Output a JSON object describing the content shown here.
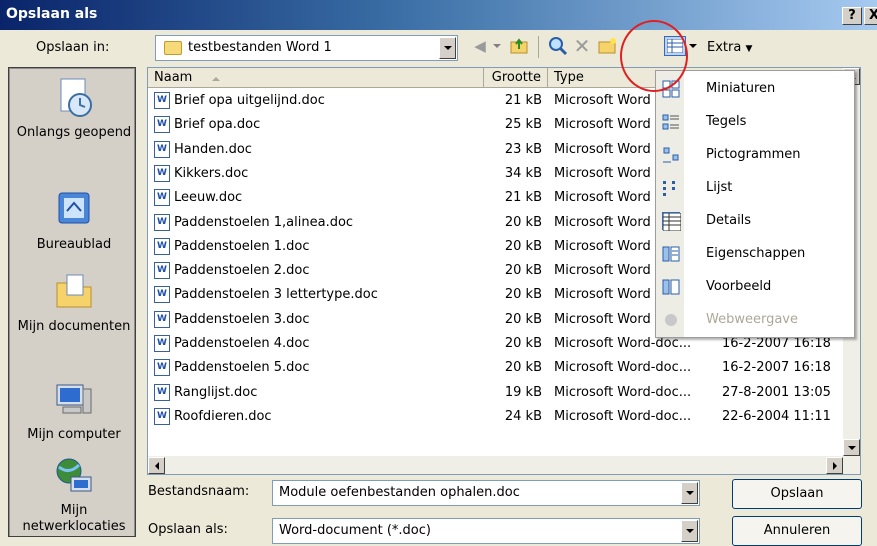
{
  "window": {
    "title": "Opslaan als",
    "help_btn": "?",
    "close_btn": "X"
  },
  "toolbar": {
    "save_in_label": "Opslaan in:",
    "save_in_value": "testbestanden Word 1",
    "extra_label": "Extra",
    "icons": [
      "back-icon",
      "up-folder-icon",
      "search-web-icon",
      "delete-icon",
      "new-folder-icon",
      "views-icon"
    ]
  },
  "places": [
    {
      "label": "Onlangs geopend",
      "icon": "recent-icon"
    },
    {
      "label": "Bureaublad",
      "icon": "desktop-icon"
    },
    {
      "label": "Mijn documenten",
      "icon": "my-documents-icon"
    },
    {
      "label": "Mijn computer",
      "icon": "my-computer-icon"
    },
    {
      "label": "Mijn netwerklocaties",
      "icon": "network-icon"
    }
  ],
  "columns": {
    "name": "Naam",
    "size": "Grootte",
    "type": "Type"
  },
  "files": [
    {
      "name": "Brief opa uitgelijnd.doc",
      "size": "21 kB",
      "type": "Microsoft Word",
      "date": ""
    },
    {
      "name": "Brief opa.doc",
      "size": "25 kB",
      "type": "Microsoft Word",
      "date": ""
    },
    {
      "name": "Handen.doc",
      "size": "23 kB",
      "type": "Microsoft Word",
      "date": ""
    },
    {
      "name": "Kikkers.doc",
      "size": "34 kB",
      "type": "Microsoft Word",
      "date": ""
    },
    {
      "name": "Leeuw.doc",
      "size": "21 kB",
      "type": "Microsoft Word",
      "date": ""
    },
    {
      "name": "Paddenstoelen 1,alinea.doc",
      "size": "20 kB",
      "type": "Microsoft Word",
      "date": ""
    },
    {
      "name": "Paddenstoelen 1.doc",
      "size": "20 kB",
      "type": "Microsoft Word",
      "date": ""
    },
    {
      "name": "Paddenstoelen 2.doc",
      "size": "20 kB",
      "type": "Microsoft Word",
      "date": ""
    },
    {
      "name": "Paddenstoelen 3 lettertype.doc",
      "size": "20 kB",
      "type": "Microsoft Word",
      "date": ""
    },
    {
      "name": "Paddenstoelen 3.doc",
      "size": "20 kB",
      "type": "Microsoft Word",
      "date": ""
    },
    {
      "name": "Paddenstoelen 4.doc",
      "size": "20 kB",
      "type": "Microsoft Word-doc...",
      "date": "16-2-2007 16:18"
    },
    {
      "name": "Paddenstoelen 5.doc",
      "size": "20 kB",
      "type": "Microsoft Word-doc...",
      "date": "16-2-2007 16:18"
    },
    {
      "name": "Ranglijst.doc",
      "size": "19 kB",
      "type": "Microsoft Word-doc...",
      "date": "27-8-2001 13:05"
    },
    {
      "name": "Roofdieren.doc",
      "size": "24 kB",
      "type": "Microsoft Word-doc...",
      "date": "22-6-2004 11:11"
    }
  ],
  "views_menu": [
    {
      "label": "Miniaturen",
      "icon": "thumbnails-icon",
      "enabled": true
    },
    {
      "label": "Tegels",
      "icon": "tiles-icon",
      "enabled": true
    },
    {
      "label": "Pictogrammen",
      "icon": "icons-view-icon",
      "enabled": true
    },
    {
      "label": "Lijst",
      "icon": "list-view-icon",
      "enabled": true
    },
    {
      "label": "Details",
      "icon": "details-view-icon",
      "enabled": true,
      "selected": true
    },
    {
      "label": "Eigenschappen",
      "icon": "properties-view-icon",
      "enabled": true
    },
    {
      "label": "Voorbeeld",
      "icon": "preview-view-icon",
      "enabled": true
    },
    {
      "label": "Webweergave",
      "icon": "webview-icon",
      "enabled": false
    }
  ],
  "footer": {
    "filename_label": "Bestandsnaam:",
    "filename_value": "Module oefenbestanden ophalen.doc",
    "save_as_label": "Opslaan als:",
    "save_as_value": "Word-document (*.doc)",
    "save_btn": "Opslaan",
    "cancel_btn": "Annuleren"
  },
  "colors": {
    "title_start": "#0A246A",
    "title_end": "#A6CAF0",
    "dialog_bg": "#ECE9D8",
    "highlight_circle": "#E02020"
  }
}
